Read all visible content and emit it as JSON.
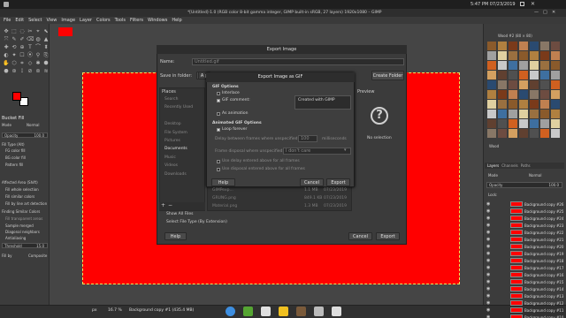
{
  "topbar": {
    "clock": "5:47 PM 07/23/2019"
  },
  "window": {
    "title": "*[Untitled]-1.0 (RGB color 8-bit gamma integer, GIMP built-in sRGB, 27 layers) 1920x1080 – GIMP"
  },
  "menu": [
    "File",
    "Edit",
    "Select",
    "View",
    "Image",
    "Layer",
    "Colors",
    "Tools",
    "Filters",
    "Windows",
    "Help"
  ],
  "tool_options": {
    "title": "Bucket Fill",
    "mode_label": "Mode",
    "mode_value": "Normal",
    "opacity_label": "Opacity",
    "opacity_value": "100.0",
    "fill_type_label": "Fill Type (Alt)",
    "fill_fg": "FG color fill",
    "fill_bg": "BG color fill",
    "fill_pattern": "Pattern fill",
    "affected_area_label": "Affected Area (Shift)",
    "fill_whole": "Fill whole selection",
    "fill_similar": "Fill similar colors",
    "fill_lineart": "Fill by line art detection",
    "finding_label": "Finding Similar Colors",
    "fill_transparent": "Fill transparent areas",
    "sample_merged": "Sample merged",
    "diagonal": "Diagonal neighbors",
    "antialiasing": "Antialiasing",
    "threshold_label": "Threshold",
    "threshold_value": "15.0",
    "fillby_label": "Fill by",
    "fillby_value": "Composite"
  },
  "export_dialog": {
    "title": "Export Image",
    "name_label": "Name:",
    "name_value": "Untitled.gif",
    "save_in_label": "Save in folder:",
    "path_seg": "A p",
    "create_folder": "Create Folder",
    "places_header": "Places",
    "places": [
      "Search",
      "Recently Used",
      "",
      "Desktop",
      "File System",
      "Pictures",
      "Documents",
      "Music",
      "Videos",
      "Downloads"
    ],
    "preview_header": "Preview",
    "no_selection": "No selection",
    "files": [
      {
        "name": "GIMPexp...",
        "size": "1.1 MB",
        "date": "07/23/2019"
      },
      {
        "name": "GRUNG.png",
        "size": "849.1 KB",
        "date": "07/23/2019"
      },
      {
        "name": "Material.png",
        "size": "1.3 MB",
        "date": "07/23/2019"
      }
    ],
    "show_all_files": "Show All Files",
    "select_file_type": "Select File Type (By Extension)",
    "help": "Help",
    "cancel": "Cancel",
    "export": "Export"
  },
  "gif_dialog": {
    "title": "Export Image as GIF",
    "gif_options": "GIF Options",
    "interlace": "Interlace",
    "gif_comment": "GIF comment:",
    "comment_value": "Created with GIMP",
    "as_animation": "As animation",
    "animated_options": "Animated GIF Options",
    "loop_forever": "Loop forever",
    "delay_label": "Delay between frames where unspecified:",
    "delay_value": "100",
    "delay_unit": "milliseconds",
    "disposal_label": "Frame disposal where unspecified:",
    "disposal_value": "I don't care",
    "use_delay": "Use delay entered above for all frames",
    "use_disposal": "Use disposal entered above for all frames",
    "help": "Help",
    "cancel": "Cancel",
    "export": "Export"
  },
  "dock": {
    "pattern_name": "Wood #2 (80 × 80)",
    "pattern_filter": "Wood",
    "layers_tab": "Layers",
    "channels_tab": "Channels",
    "paths_tab": "Paths",
    "mode_label": "Mode",
    "mode_value": "Normal",
    "opacity_label": "Opacity",
    "opacity_value": "100.0",
    "lock_label": "Lock:",
    "layers": [
      "Background copy #26",
      "Background copy #25",
      "Background copy #24",
      "Background copy #23",
      "Background copy #22",
      "Background copy #21",
      "Background copy #20",
      "Background copy #19",
      "Background copy #18",
      "Background copy #17",
      "Background copy #16",
      "Background copy #15",
      "Background copy #14",
      "Background copy #13",
      "Background copy #12",
      "Background copy #11",
      "Background copy #10"
    ]
  },
  "status": {
    "unit": "px",
    "zoom": "16.7 %",
    "layer_info": "Background copy #1 (435.4 MB)"
  },
  "colors": {
    "accent_red": "#ff0000",
    "dialog_bg": "#3b3b3b"
  }
}
